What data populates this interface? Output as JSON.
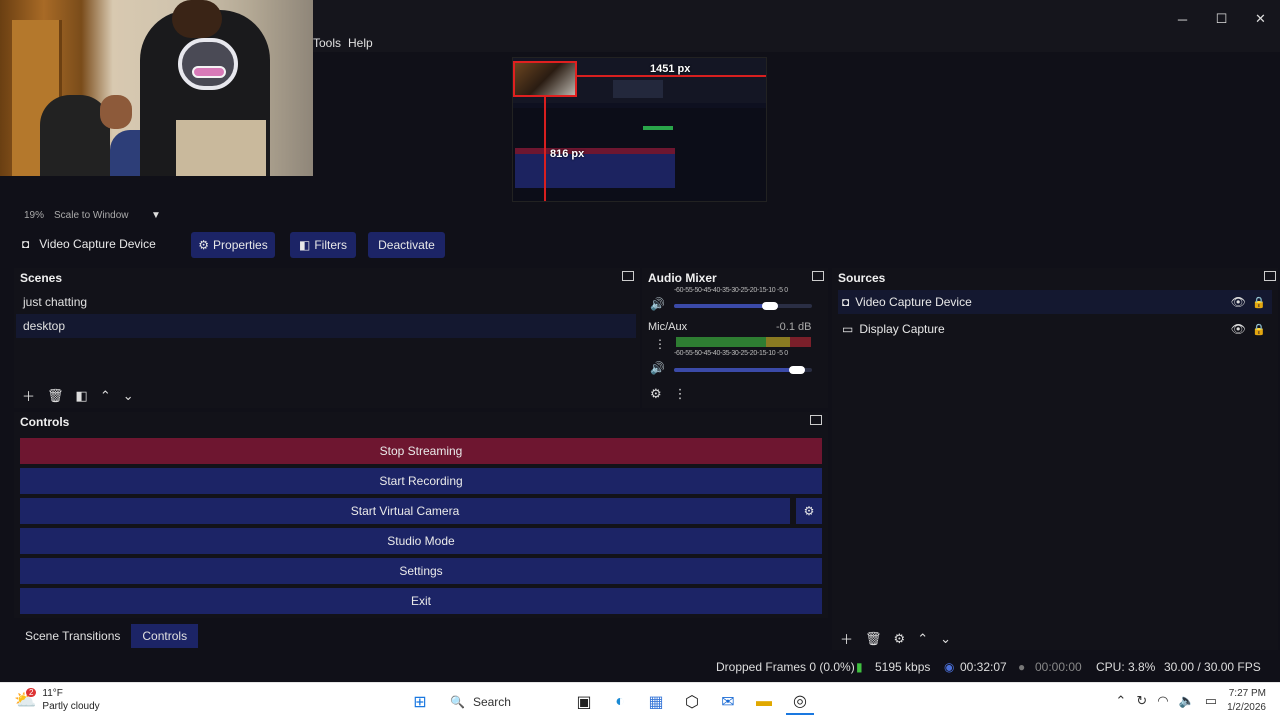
{
  "menu": {
    "tools": "Tools",
    "help": "Help"
  },
  "window_controls": {
    "minimize": "─",
    "maximize": "☐",
    "close": "✕"
  },
  "preview": {
    "width_measure": "1451 px",
    "height_measure": "816 px",
    "zoom": "19%",
    "scale_mode": "Scale to Window"
  },
  "source_toolbar": {
    "source_name": "Video Capture Device",
    "properties": "Properties",
    "filters": "Filters",
    "deactivate": "Deactivate"
  },
  "scenes": {
    "title": "Scenes",
    "items": [
      {
        "label": "just chatting"
      },
      {
        "label": "desktop"
      }
    ]
  },
  "audio_mixer": {
    "title": "Audio Mixer",
    "scale": "-60-55-50-45-40-35-30-25-20-15-10 -5 0",
    "tracks": [
      {
        "name": "Mic/Aux",
        "level": "-0.1 dB",
        "fader": 0.95
      }
    ],
    "first_track_fader": 0.75
  },
  "sources": {
    "title": "Sources",
    "items": [
      {
        "label": "Video Capture Device",
        "icon": "camera-icon"
      },
      {
        "label": "Display Capture",
        "icon": "monitor-icon"
      }
    ]
  },
  "controls": {
    "title": "Controls",
    "stop_streaming": "Stop Streaming",
    "start_recording": "Start Recording",
    "start_virtual_camera": "Start Virtual Camera",
    "studio_mode": "Studio Mode",
    "settings": "Settings",
    "exit": "Exit"
  },
  "dock_tabs": [
    {
      "label": "Scene Transitions"
    },
    {
      "label": "Controls"
    }
  ],
  "status": {
    "dropped_frames": "Dropped Frames 0 (0.0%)",
    "bitrate": "5195 kbps",
    "stream_time": "00:32:07",
    "record_time": "00:00:00",
    "cpu": "CPU: 3.8%",
    "fps": "30.00 / 30.00 FPS"
  },
  "taskbar": {
    "weather_temp": "11°F",
    "weather_desc": "Partly cloudy",
    "weather_badge": "2",
    "search": "Search",
    "time": "7:27 PM",
    "date": "1/2/2026"
  },
  "colors": {
    "accent_blue": "#1c2466",
    "stop_red": "#6e1630",
    "panel_bg": "#121219"
  }
}
